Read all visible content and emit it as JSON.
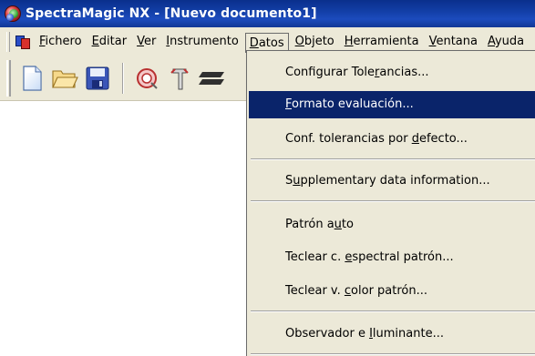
{
  "window": {
    "app_name": "SpectraMagic NX",
    "title": "SpectraMagic NX - [Nuevo documento1]",
    "icon": "spectramagic-logo"
  },
  "menubar": {
    "items": [
      {
        "label": "Fichero",
        "u": "F",
        "rest": "ichero"
      },
      {
        "label": "Editar",
        "u": "E",
        "rest": "ditar"
      },
      {
        "label": "Ver",
        "u": "V",
        "rest": "er"
      },
      {
        "label": "Instrumento",
        "u": "I",
        "rest": "nstrumento"
      },
      {
        "label": "Datos",
        "u": "D",
        "rest": "atos"
      },
      {
        "label": "Objeto",
        "u": "O",
        "rest": "bjeto"
      },
      {
        "label": "Herramienta",
        "u": "H",
        "rest": "erramienta"
      },
      {
        "label": "Ventana",
        "u": "V",
        "rest": "entana"
      },
      {
        "label": "Ayuda",
        "u": "A",
        "rest": "yuda"
      }
    ],
    "active": "Datos"
  },
  "toolbar": {
    "buttons": [
      "new-document-icon",
      "open-folder-icon",
      "save-disk-icon",
      "target-icon",
      "instrument-icon",
      "stack-icon"
    ]
  },
  "datos_menu": {
    "items": [
      {
        "pre": "Configurar Tole",
        "u": "r",
        "post": "ancias..."
      },
      {
        "pre": "",
        "u": "F",
        "post": "ormato evaluación..."
      },
      {
        "pre": "Conf. tolerancias por ",
        "u": "d",
        "post": "efecto..."
      },
      {
        "pre": "S",
        "u": "u",
        "post": "pplementary data information..."
      },
      {
        "pre": "Patrón a",
        "u": "u",
        "post": "to"
      },
      {
        "pre": "Teclear c. ",
        "u": "e",
        "post": "spectral patrón..."
      },
      {
        "pre": "Teclear v. ",
        "u": "c",
        "post": "olor patrón..."
      },
      {
        "pre": "Observador e ",
        "u": "I",
        "post": "luminante..."
      }
    ],
    "highlighted_index": 1
  },
  "colors": {
    "titlebar": "#123ea6",
    "menu_bg": "#ece9d8",
    "highlight": "#0a246a"
  }
}
